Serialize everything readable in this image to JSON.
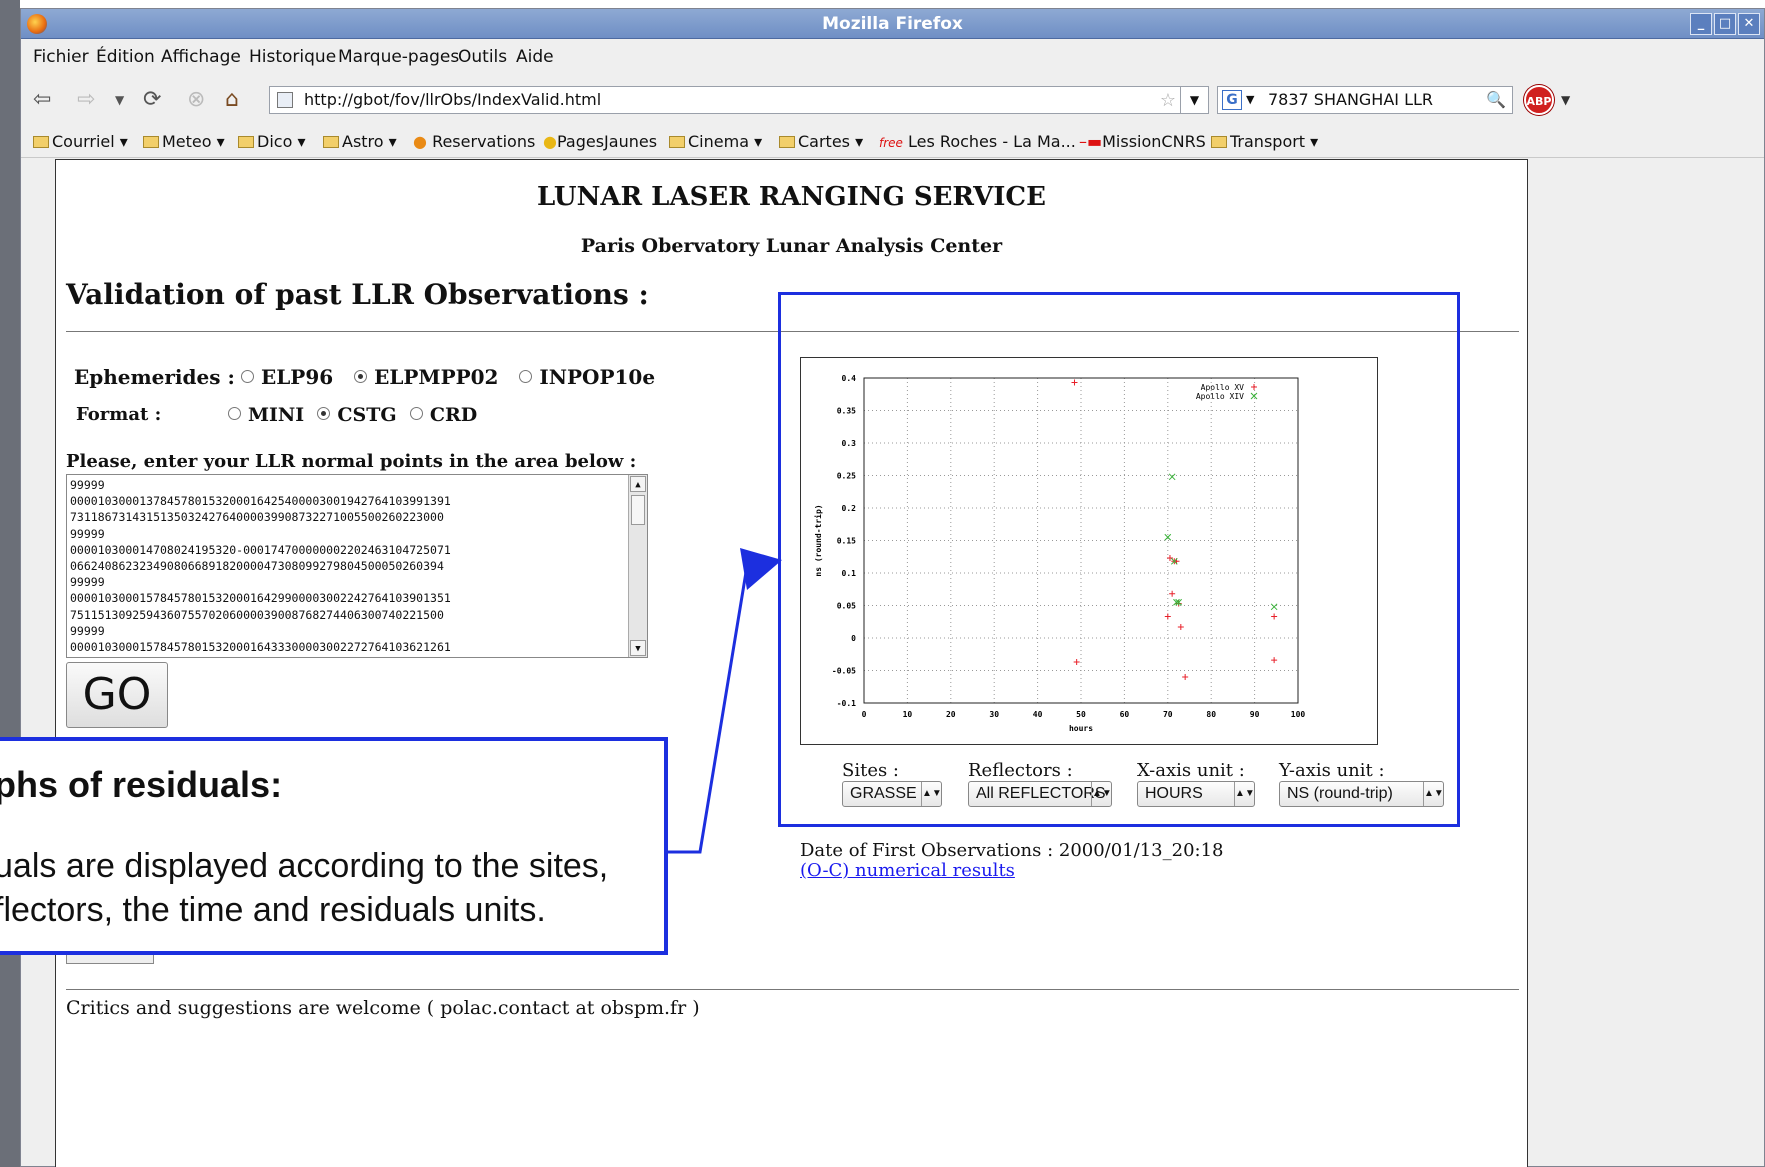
{
  "window": {
    "title": "Mozilla Firefox"
  },
  "menu": [
    "Fichier",
    "Édition",
    "Affichage",
    "Historique",
    "Marque-pages",
    "Outils",
    "Aide"
  ],
  "nav": {
    "url": "http://gbot/fov/llrObs/IndexValid.html",
    "search": "7837   SHANGHAI LLR",
    "abp": "ABP"
  },
  "bookmarks": [
    "Courriel",
    "Meteo",
    "Dico",
    "Astro",
    "Reservations",
    "PagesJaunes",
    "Cinema",
    "Cartes",
    "Les Roches - La Ma...",
    "MissionCNRS",
    "Transport"
  ],
  "page": {
    "title": "LUNAR LASER RANGING SERVICE",
    "subtitle": "Paris Obervatory Lunar Analysis Center",
    "heading": "Validation of past LLR Observations :",
    "ephemerides_label": "Ephemerides :",
    "ephemerides": [
      "ELP96",
      "ELPMPP02",
      "INPOP10e"
    ],
    "ephemerides_selected": "ELPMPP02",
    "format_label": "Format :",
    "formats": [
      "MINI",
      "CSTG",
      "CRD"
    ],
    "format_selected": "CSTG",
    "enter_label": "Please, enter your LLR normal points in the area below :",
    "normal_points": [
      "99999",
      "00001030001378457801532000164254000030019427641039913​91",
      "7311867314315135032427640000399087322710055002602230​00",
      "99999",
      "00001030001470802419532​0-000174700000002202463104725071",
      "0662408623234908066891820000473080992798045000502603​94",
      "99999",
      "00001030001578457801532000164299000030022427641039013​51",
      "7511513092594360755702060000390087682744063007402215​00",
      "99999",
      "00001030001578457801532000164333000030022727641036212​61"
    ],
    "go_label": "GO",
    "first_obs": "Date of First Observations : 2000/01/13_20:18",
    "results_link": "(O-C) numerical results",
    "critics": "Critics and suggestions are welcome ( polac.contact at obspm.fr )"
  },
  "graph_controls": {
    "sites_label": "Sites :",
    "sites_value": "GRASSE",
    "reflectors_label": "Reflectors :",
    "reflectors_value": "All REFLECTORS",
    "xunit_label": "X-axis unit :",
    "xunit_value": "HOURS",
    "yunit_label": "Y-axis unit :",
    "yunit_value": "NS (round-trip)"
  },
  "callout": {
    "title": "phs of residuals:",
    "line1": "uals are displayed according to the sites,",
    "line2": "flectors, the time and residuals units."
  },
  "colors": {
    "accent": "#1c2fdf",
    "series1": "#e8202a",
    "series2": "#38b238",
    "link": "#1a1aee"
  },
  "chart_data": {
    "type": "scatter",
    "xlabel": "hours",
    "ylabel": "ns (round-trip)",
    "xlim": [
      0,
      100
    ],
    "ylim": [
      -0.1,
      0.4
    ],
    "xticks": [
      "0",
      "10",
      "20",
      "30",
      "40",
      "50",
      "60",
      "70",
      "80",
      "90",
      "100"
    ],
    "yticks": [
      "-0.1",
      "-0.05",
      "0",
      "0.05",
      "0.1",
      "0.15",
      "0.2",
      "0.25",
      "0.3",
      "0.35",
      "0.4"
    ],
    "grid": true,
    "legend": "top-right",
    "series": [
      {
        "name": "Apollo XV",
        "marker": "+",
        "color": "#e8202a",
        "points": [
          [
            48.5,
            0.393
          ],
          [
            49.0,
            -0.037
          ],
          [
            70.0,
            0.033
          ],
          [
            70.5,
            0.123
          ],
          [
            71.0,
            0.068
          ],
          [
            71.5,
            0.118
          ],
          [
            72.0,
            0.118
          ],
          [
            72.5,
            0.053
          ],
          [
            73.0,
            0.017
          ],
          [
            74.0,
            -0.06
          ],
          [
            94.5,
            0.033
          ],
          [
            94.5,
            -0.034
          ]
        ]
      },
      {
        "name": "Apollo XIV",
        "marker": "x",
        "color": "#38b238",
        "points": [
          [
            70.0,
            0.155
          ],
          [
            71.0,
            0.248
          ],
          [
            71.5,
            0.118
          ],
          [
            72.0,
            0.055
          ],
          [
            72.5,
            0.055
          ],
          [
            94.5,
            0.048
          ]
        ]
      }
    ]
  }
}
